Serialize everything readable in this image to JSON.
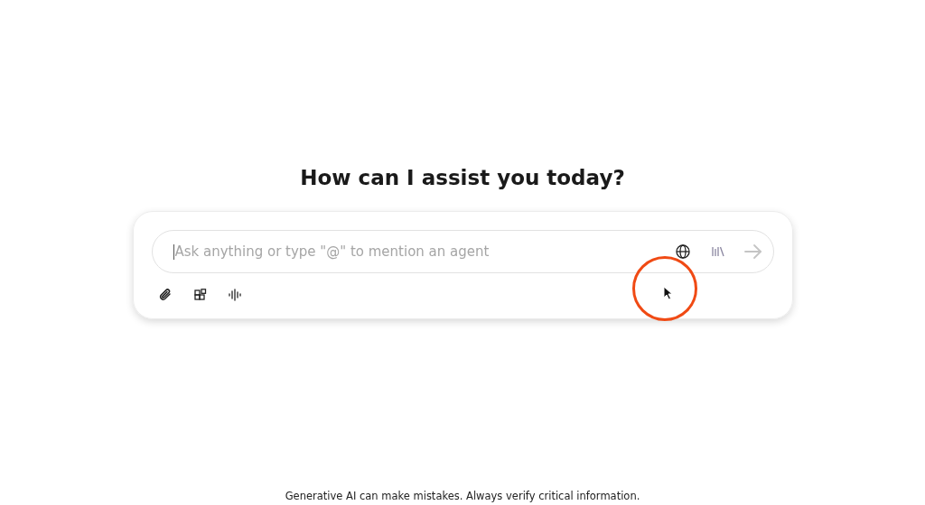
{
  "heading": "How can I assist you today?",
  "prompt": {
    "placeholder": "Ask anything or type \"@\" to mention an agent",
    "send_disabled": true
  },
  "footer": "Generative AI can make mistakes. Always verify critical information."
}
